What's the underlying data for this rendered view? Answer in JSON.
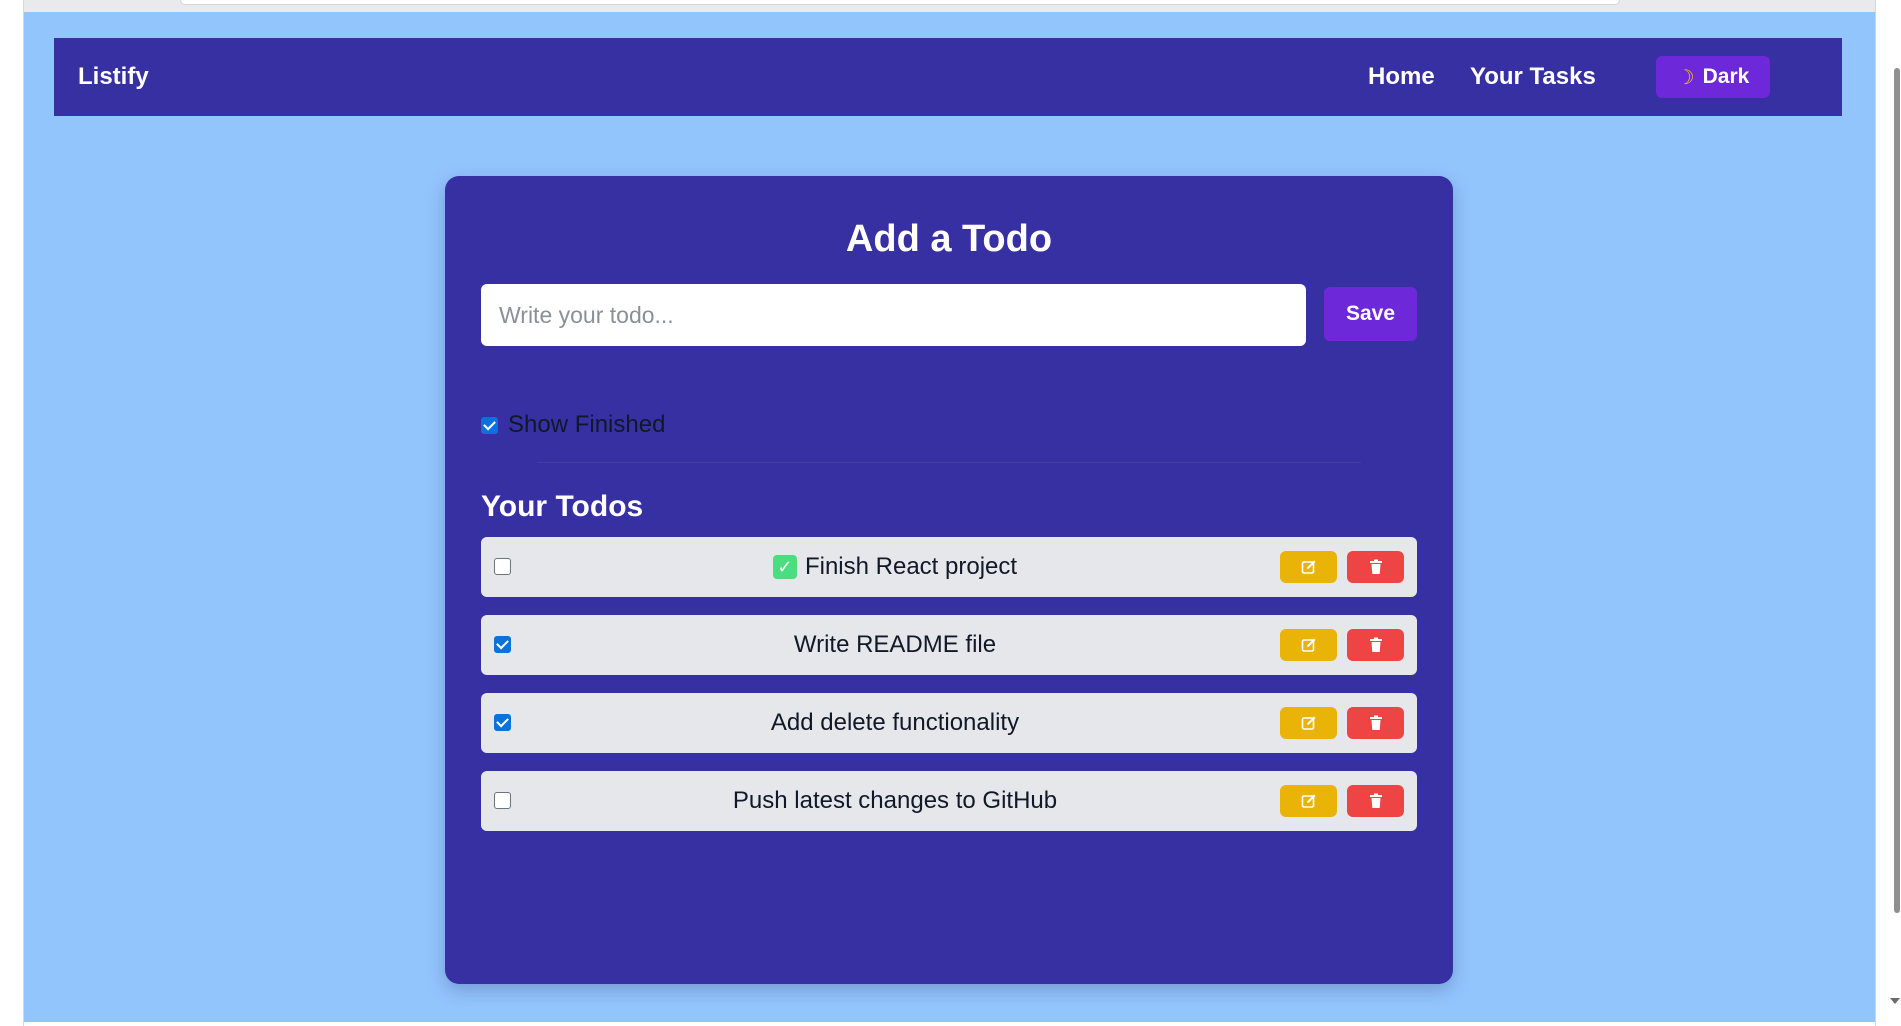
{
  "navbar": {
    "brand": "Listify",
    "links": [
      {
        "label": "Home"
      },
      {
        "label": "Your Tasks"
      }
    ],
    "theme_toggle": {
      "icon": "moon-icon",
      "label": "Dark"
    }
  },
  "form": {
    "title": "Add a Todo",
    "input_value": "",
    "input_placeholder": "Write your todo...",
    "save_label": "Save",
    "show_finished": {
      "label": "Show Finished",
      "checked": true
    }
  },
  "list": {
    "title": "Your Todos",
    "items": [
      {
        "text": "Finish React project",
        "done": false,
        "emoji": "check-mark-button-icon"
      },
      {
        "text": "Write README file",
        "done": true
      },
      {
        "text": "Add delete functionality",
        "done": true
      },
      {
        "text": "Push latest changes to GitHub",
        "done": false
      }
    ],
    "item_actions": {
      "edit_icon": "edit-icon",
      "delete_icon": "trash-icon"
    }
  },
  "colors": {
    "page_bg": "#93c5fd",
    "navbar_bg": "#3730a3",
    "accent": "#6d28d9",
    "edit": "#eab308",
    "delete": "#ef4444",
    "row_bg": "#e5e7eb"
  }
}
